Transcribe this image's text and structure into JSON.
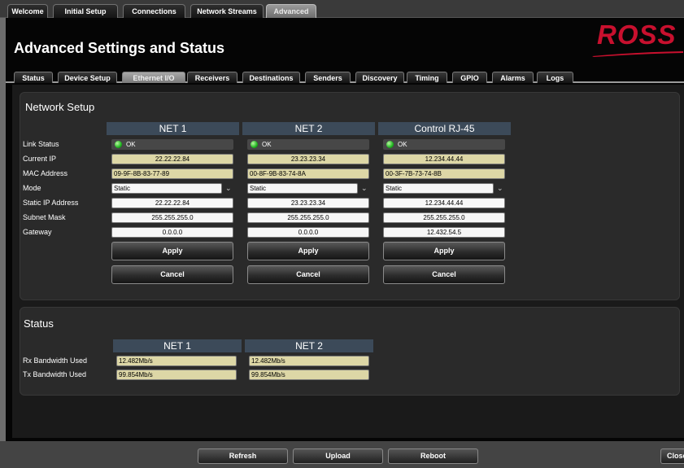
{
  "top_tabs": [
    "Welcome",
    "Initial Setup",
    "Connections",
    "Network Streams",
    "Advanced"
  ],
  "title": "Advanced Settings and Status",
  "logo_text": "ROSS",
  "sub_tabs": [
    "Status",
    "Device Setup",
    "Ethernet I/O",
    "Receivers",
    "Destinations",
    "Senders",
    "Discovery",
    "Timing",
    "GPIO",
    "Alarms",
    "Logs"
  ],
  "network_setup": {
    "title": "Network Setup",
    "columns": [
      "NET 1",
      "NET 2",
      "Control RJ-45"
    ],
    "row_labels": [
      "Link Status",
      "Current IP",
      "MAC Address",
      "Mode",
      "Static IP Address",
      "Subnet Mask",
      "Gateway"
    ],
    "link_status": [
      "OK",
      "OK",
      "OK"
    ],
    "current_ip": [
      "22.22.22.84",
      "23.23.23.34",
      "12.234.44.44"
    ],
    "mac_address": [
      "09-9F-8B-83-77-89",
      "00-8F-9B-83-74-8A",
      "00-3F-7B-73-74-8B"
    ],
    "mode": [
      "Static",
      "Static",
      "Static"
    ],
    "static_ip": [
      "22.22.22.84",
      "23.23.23.34",
      "12.234.44.44"
    ],
    "subnet_mask": [
      "255.255.255.0",
      "255.255.255.0",
      "255.255.255.0"
    ],
    "gateway": [
      "0.0.0.0",
      "0.0.0.0",
      "12.432.54.5"
    ],
    "apply_label": "Apply",
    "cancel_label": "Cancel"
  },
  "status": {
    "title": "Status",
    "columns": [
      "NET 1",
      "NET 2"
    ],
    "row_labels": [
      "Rx Bandwidth Used",
      "Tx Bandwidth Used"
    ],
    "rx": [
      "12.482Mb/s",
      "12.482Mb/s"
    ],
    "tx": [
      "99.854Mb/s",
      "99.854Mb/s"
    ]
  },
  "bottom_buttons": {
    "refresh": "Refresh",
    "upload": "Upload",
    "reboot": "Reboot",
    "close": "Close"
  },
  "colors": {
    "brand_red": "#c8102e",
    "column_header": "#3c4a59",
    "readonly_field": "#ddd7a6",
    "led_ok": "#1fb51f"
  }
}
